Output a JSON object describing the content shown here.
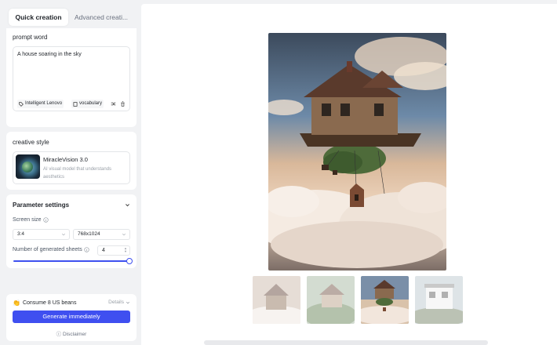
{
  "tabs": [
    {
      "label": "Quick creation",
      "active": true
    },
    {
      "label": "Advanced creati...",
      "active": false
    }
  ],
  "prompt": {
    "title": "prompt word",
    "value": "A house soaring in the sky",
    "chips": [
      "Intelligent Lenovo",
      "vocabulary"
    ]
  },
  "style": {
    "title": "creative style",
    "model_name": "MiracleVision 3.0",
    "model_desc": "AI visual model that understands aesthetics"
  },
  "params": {
    "title": "Parameter settings",
    "screen_size_label": "Screen size",
    "ratio_value": "3:4",
    "resolution_value": "768x1024",
    "sheets_label": "Number of generated sheets",
    "sheets_value": "4",
    "sheets_fraction": 1.0
  },
  "footer": {
    "consume": "Consume 8 US beans",
    "details": "Details",
    "generate": "Generate immediately",
    "disclaimer": "Disclaimer"
  },
  "colors": {
    "accent": "#3f4ff0",
    "background": "#f1f2f4"
  },
  "preview": {
    "selected_index": 2,
    "thumbnail_count": 4
  }
}
